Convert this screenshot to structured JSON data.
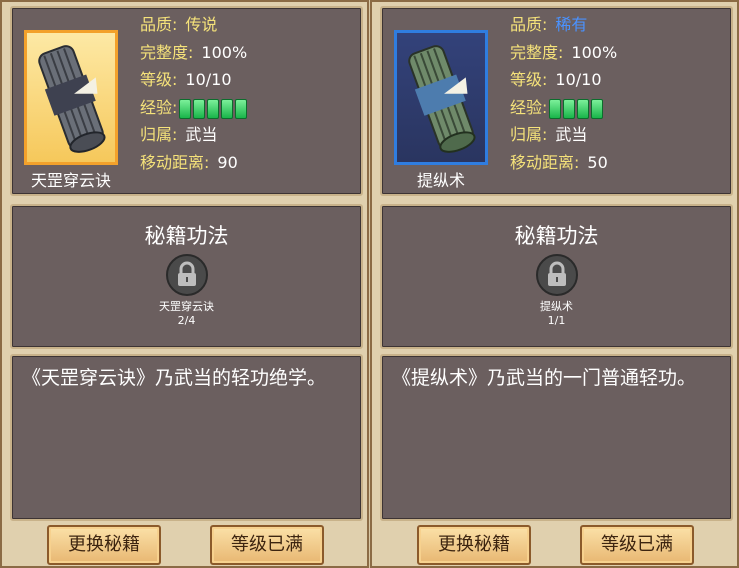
{
  "labels": {
    "quality": "品质:",
    "integrity": "完整度:",
    "level": "等级:",
    "exp": "经验:",
    "belongs": "归属:",
    "move": "移动距离:"
  },
  "left": {
    "item_name": "天罡穿云诀",
    "quality": "传说",
    "integrity": "100%",
    "level": "10/10",
    "exp_pips": 5,
    "belongs": "武当",
    "move": "90",
    "section_title": "秘籍功法",
    "skill_name": "天罡穿云诀",
    "skill_count": "2/4",
    "description": "《天罡穿云诀》乃武当的轻功绝学。",
    "btn_replace": "更换秘籍",
    "btn_level": "等级已满"
  },
  "right": {
    "item_name": "提纵术",
    "quality": "稀有",
    "integrity": "100%",
    "level": "10/10",
    "exp_pips": 4,
    "belongs": "武当",
    "move": "50",
    "section_title": "秘籍功法",
    "skill_name": "提纵术",
    "skill_count": "1/1",
    "description": "《提纵术》乃武当的一门普通轻功。",
    "btn_replace": "更换秘籍",
    "btn_level": "等级已满"
  },
  "colors": {
    "legend": "#f5e27a",
    "rare": "#4a92ff",
    "exp_pip": "#2ed063"
  }
}
